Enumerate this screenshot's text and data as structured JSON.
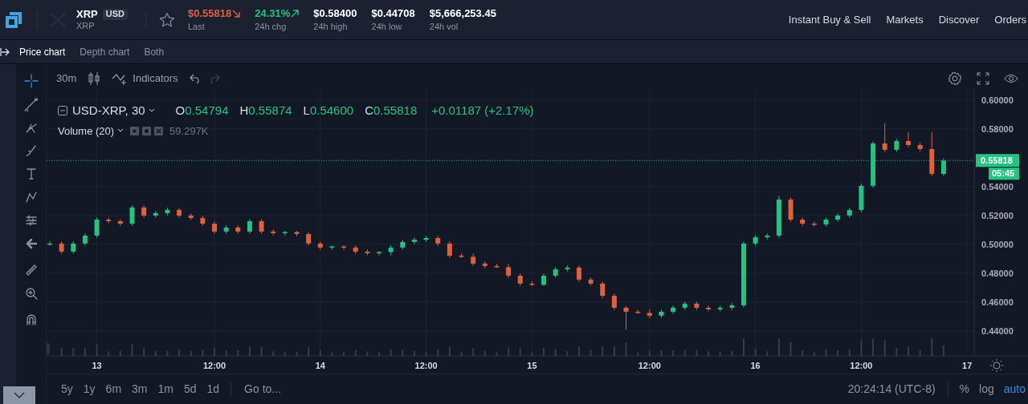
{
  "header": {
    "pair": {
      "base": "XRP",
      "quote": "USD",
      "name": "XRP"
    },
    "favorite": false,
    "stats": [
      {
        "value": "$0.55818",
        "label": "Last",
        "kind": "falling"
      },
      {
        "value": "24.31%",
        "label": "24h chg",
        "kind": "rising"
      },
      {
        "value": "$0.58400",
        "label": "24h high",
        "kind": "plain"
      },
      {
        "value": "$0.44708",
        "label": "24h low",
        "kind": "plain"
      },
      {
        "value": "$5,666,253.45",
        "label": "24h vol",
        "kind": "plain"
      }
    ],
    "nav": [
      "Instant Buy & Sell",
      "Markets",
      "Discover",
      "Orders"
    ]
  },
  "chart_tabs": [
    {
      "label": "Price chart",
      "selected": true
    },
    {
      "label": "Depth chart",
      "selected": false
    },
    {
      "label": "Both",
      "selected": false
    }
  ],
  "drawing_tools": [
    {
      "kind": "crosshair",
      "selected": true
    },
    {
      "kind": "trendline",
      "selected": false
    },
    {
      "kind": "fork",
      "selected": false
    },
    {
      "kind": "brush",
      "selected": false
    },
    {
      "kind": "text",
      "selected": false
    },
    {
      "kind": "pattern",
      "selected": false
    },
    {
      "kind": "measure",
      "selected": false
    },
    {
      "kind": "back",
      "selected": false
    },
    {
      "kind": "ruler",
      "selected": false
    },
    {
      "kind": "zoom",
      "selected": false
    },
    {
      "kind": "magnet",
      "selected": false
    }
  ],
  "toolbar": {
    "interval": "30m",
    "indicators": "Indicators"
  },
  "legend": {
    "symbol": "USD-XRP, 30",
    "ohlc": [
      {
        "key": "O",
        "value": "0.54794"
      },
      {
        "key": "H",
        "value": "0.55874"
      },
      {
        "key": "L",
        "value": "0.54600"
      },
      {
        "key": "C",
        "value": "0.55818"
      }
    ],
    "change": "+0.01187 (+2.17%)",
    "volume_label": "Volume (20)",
    "volume_value": "59.297K"
  },
  "countdown": "05:45",
  "chart_data": {
    "type": "candlestick",
    "grid": true,
    "ylim": [
      0.4227,
      0.6072
    ],
    "ref_lines": [
      {
        "axis": "y",
        "value": 0.55818,
        "label": "0.55818",
        "color": "#26c281"
      }
    ],
    "categories": [
      null,
      null,
      null,
      null,
      "13",
      null,
      null,
      null,
      null,
      null,
      null,
      null,
      null,
      null,
      "12:00",
      null,
      null,
      null,
      null,
      null,
      null,
      null,
      null,
      "14",
      null,
      null,
      null,
      null,
      null,
      null,
      null,
      null,
      "12:00",
      null,
      null,
      null,
      null,
      null,
      null,
      null,
      null,
      "15",
      null,
      null,
      null,
      null,
      null,
      null,
      null,
      null,
      null,
      "12:00",
      null,
      null,
      null,
      null,
      null,
      null,
      null,
      null,
      "16",
      null,
      null,
      null,
      null,
      null,
      null,
      null,
      null,
      "12:00",
      null,
      null,
      null,
      null,
      null,
      null,
      null,
      null,
      "17"
    ],
    "yticks": [
      {
        "value": 0.6,
        "label": "0.60000"
      },
      {
        "value": 0.58,
        "label": "0.58000"
      },
      {
        "value": 0.54,
        "label": "0.54000"
      },
      {
        "value": 0.52,
        "label": "0.52000"
      },
      {
        "value": 0.5,
        "label": "0.50000"
      },
      {
        "value": 0.48,
        "label": "0.48000"
      },
      {
        "value": 0.46,
        "label": "0.46000"
      },
      {
        "value": 0.44,
        "label": "0.44000"
      }
    ],
    "ohlc": [
      [
        0.5006,
        0.5021,
        0.4991,
        0.5006
      ],
      [
        0.5006,
        0.5021,
        0.4935,
        0.495
      ],
      [
        0.495,
        0.5021,
        0.4935,
        0.5006
      ],
      [
        0.5006,
        0.5076,
        0.4991,
        0.5061
      ],
      [
        0.5061,
        0.5187,
        0.5046,
        0.5172
      ],
      [
        0.5172,
        0.5187,
        0.5146,
        0.5161
      ],
      [
        0.5161,
        0.5176,
        0.5129,
        0.5144
      ],
      [
        0.5144,
        0.5271,
        0.5129,
        0.5256
      ],
      [
        0.5256,
        0.5271,
        0.5185,
        0.52
      ],
      [
        0.52,
        0.5232,
        0.5185,
        0.5217
      ],
      [
        0.5217,
        0.5254,
        0.5202,
        0.5239
      ],
      [
        0.5239,
        0.5254,
        0.5185,
        0.52
      ],
      [
        0.52,
        0.5215,
        0.5168,
        0.5183
      ],
      [
        0.5183,
        0.5198,
        0.5129,
        0.5144
      ],
      [
        0.5144,
        0.5159,
        0.5074,
        0.5089
      ],
      [
        0.5089,
        0.5132,
        0.5074,
        0.5117
      ],
      [
        0.5117,
        0.5132,
        0.5074,
        0.5089
      ],
      [
        0.5089,
        0.5176,
        0.5074,
        0.5161
      ],
      [
        0.5161,
        0.5176,
        0.5074,
        0.5089
      ],
      [
        0.5089,
        0.5104,
        0.5063,
        0.5078
      ],
      [
        0.5078,
        0.5093,
        0.5063,
        0.5086
      ],
      [
        0.5086,
        0.5093,
        0.5057,
        0.5072
      ],
      [
        0.5072,
        0.5087,
        0.4991,
        0.5006
      ],
      [
        0.5006,
        0.5021,
        0.4963,
        0.4978
      ],
      [
        0.4978,
        0.4993,
        0.4963,
        0.4986
      ],
      [
        0.4986,
        0.4993,
        0.4963,
        0.4978
      ],
      [
        0.4978,
        0.4993,
        0.4935,
        0.495
      ],
      [
        0.495,
        0.4965,
        0.4924,
        0.4939
      ],
      [
        0.4939,
        0.4954,
        0.4924,
        0.4947
      ],
      [
        0.4947,
        0.4993,
        0.4924,
        0.4978
      ],
      [
        0.4978,
        0.5032,
        0.4963,
        0.5017
      ],
      [
        0.5017,
        0.5048,
        0.5002,
        0.5033
      ],
      [
        0.5033,
        0.5059,
        0.5018,
        0.5044
      ],
      [
        0.5044,
        0.5059,
        0.4991,
        0.5006
      ],
      [
        0.5006,
        0.5021,
        0.4907,
        0.4922
      ],
      [
        0.4922,
        0.4937,
        0.4907,
        0.4914
      ],
      [
        0.4914,
        0.4937,
        0.4852,
        0.4867
      ],
      [
        0.4867,
        0.4882,
        0.4835,
        0.485
      ],
      [
        0.485,
        0.4865,
        0.4835,
        0.4842
      ],
      [
        0.4842,
        0.4865,
        0.4768,
        0.4783
      ],
      [
        0.4783,
        0.4798,
        0.4713,
        0.4728
      ],
      [
        0.4728,
        0.4743,
        0.4713,
        0.472
      ],
      [
        0.472,
        0.4798,
        0.4713,
        0.4783
      ],
      [
        0.4783,
        0.4843,
        0.4768,
        0.4828
      ],
      [
        0.4828,
        0.4854,
        0.4813,
        0.4839
      ],
      [
        0.4839,
        0.4854,
        0.4741,
        0.4756
      ],
      [
        0.4756,
        0.4771,
        0.4713,
        0.4728
      ],
      [
        0.4728,
        0.4743,
        0.4629,
        0.4644
      ],
      [
        0.4644,
        0.4659,
        0.4546,
        0.4561
      ],
      [
        0.4561,
        0.4576,
        0.441,
        0.4533
      ],
      [
        0.4533,
        0.4548,
        0.4518,
        0.4525
      ],
      [
        0.4525,
        0.4548,
        0.4491,
        0.4506
      ],
      [
        0.4506,
        0.4548,
        0.4491,
        0.4533
      ],
      [
        0.4533,
        0.4576,
        0.4518,
        0.4561
      ],
      [
        0.4561,
        0.4604,
        0.4546,
        0.4589
      ],
      [
        0.4589,
        0.4604,
        0.4546,
        0.4561
      ],
      [
        0.4561,
        0.4576,
        0.4535,
        0.455
      ],
      [
        0.455,
        0.4576,
        0.4535,
        0.4561
      ],
      [
        0.4561,
        0.4593,
        0.4546,
        0.4578
      ],
      [
        0.4578,
        0.5021,
        0.4563,
        0.5006
      ],
      [
        0.5006,
        0.5065,
        0.4991,
        0.505
      ],
      [
        0.505,
        0.5076,
        0.5035,
        0.5061
      ],
      [
        0.5061,
        0.5336,
        0.5046,
        0.5311
      ],
      [
        0.5311,
        0.5326,
        0.5157,
        0.5172
      ],
      [
        0.5172,
        0.5187,
        0.5129,
        0.5144
      ],
      [
        0.5144,
        0.5159,
        0.5124,
        0.5139
      ],
      [
        0.5139,
        0.5187,
        0.5124,
        0.5172
      ],
      [
        0.5172,
        0.5215,
        0.5157,
        0.52
      ],
      [
        0.52,
        0.5254,
        0.5185,
        0.5239
      ],
      [
        0.5239,
        0.5421,
        0.5224,
        0.5406
      ],
      [
        0.5406,
        0.5715,
        0.5391,
        0.57
      ],
      [
        0.57,
        0.584,
        0.5641,
        0.5656
      ],
      [
        0.5656,
        0.5732,
        0.5641,
        0.5717
      ],
      [
        0.5717,
        0.5778,
        0.5674,
        0.5689
      ],
      [
        0.5689,
        0.5704,
        0.5646,
        0.5661
      ],
      [
        0.5661,
        0.5778,
        0.5474,
        0.5489
      ],
      [
        0.5489,
        0.5597,
        0.5474,
        0.5582
      ],
      null,
      null
    ]
  },
  "ranges": [
    "5y",
    "1y",
    "6m",
    "3m",
    "1m",
    "5d",
    "1d"
  ],
  "goto": "Go to...",
  "status": {
    "time": "20:24:14 (UTC-8)",
    "options": [
      {
        "label": "%",
        "on": false
      },
      {
        "label": "log",
        "on": false
      },
      {
        "label": "auto",
        "on": true
      }
    ]
  }
}
